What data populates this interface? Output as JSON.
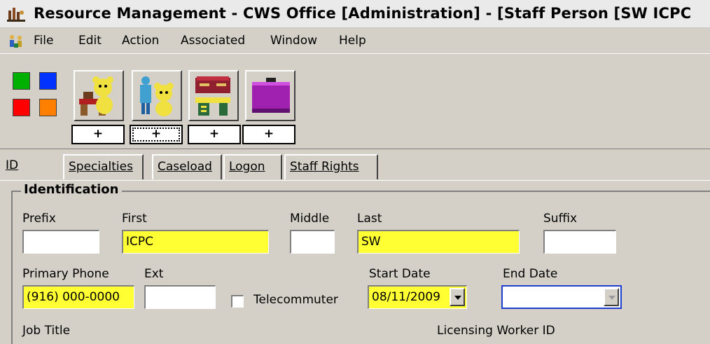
{
  "window": {
    "title": "Resource Management - CWS Office [Administration] - [Staff Person [SW ICPC"
  },
  "menu": {
    "items": [
      "File",
      "Edit",
      "Action",
      "Associated",
      "Window",
      "Help"
    ]
  },
  "toolbar": {
    "color_squares": [
      "#00b000",
      "#0033ff",
      "#ff0000",
      "#ff8000"
    ],
    "buttons": [
      {
        "icon": "teddy-bear-desk-icon",
        "add_label": "+"
      },
      {
        "icon": "person-with-teddy-bear-icon",
        "add_label": "+"
      },
      {
        "icon": "cabinet-and-desk-icon",
        "add_label": "+"
      },
      {
        "icon": "purple-folder-icon",
        "add_label": "+"
      }
    ]
  },
  "tabs": [
    {
      "label": "ID",
      "active": true
    },
    {
      "label": "Specialties",
      "active": false
    },
    {
      "label": "Caseload",
      "active": false
    },
    {
      "label": "Logon",
      "active": false
    },
    {
      "label": "Staff Rights",
      "active": false
    }
  ],
  "identification": {
    "legend": "Identification",
    "prefix": {
      "label": "Prefix",
      "value": ""
    },
    "first": {
      "label": "First",
      "value": "ICPC"
    },
    "middle": {
      "label": "Middle",
      "value": ""
    },
    "last": {
      "label": "Last",
      "value": "SW"
    },
    "suffix": {
      "label": "Suffix",
      "value": ""
    },
    "primary_phone": {
      "label": "Primary Phone",
      "value": "(916) 000-0000"
    },
    "ext": {
      "label": "Ext",
      "value": ""
    },
    "telecommuter": {
      "label": "Telecommuter",
      "checked": false
    },
    "start_date": {
      "label": "Start Date",
      "value": "08/11/2009"
    },
    "end_date": {
      "label": "End Date",
      "value": ""
    },
    "job_title": {
      "label": "Job Title"
    },
    "licensing_worker_id": {
      "label": "Licensing Worker ID"
    }
  },
  "colors": {
    "required_field": "#ffff33",
    "focus_border": "#1c3fd1",
    "window_bg": "#d4d0c8"
  }
}
